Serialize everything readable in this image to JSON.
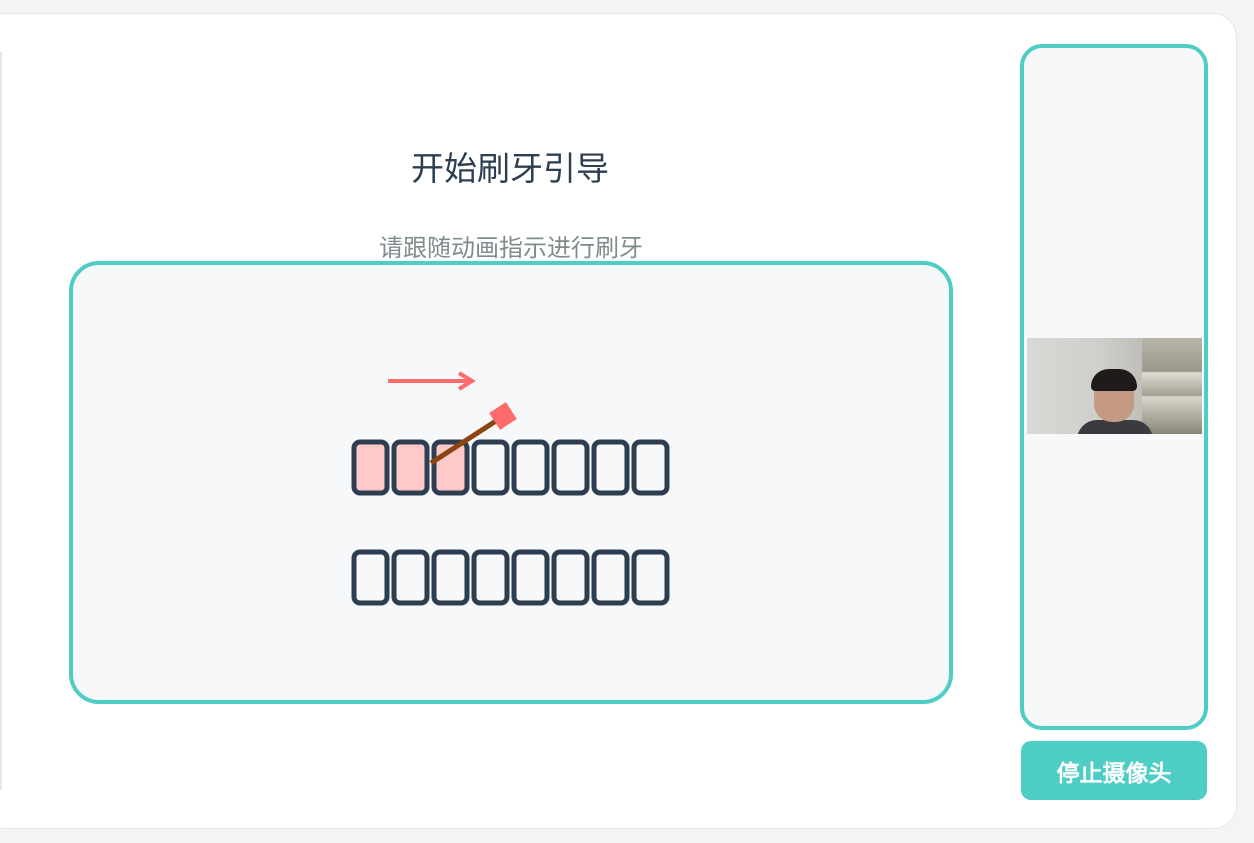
{
  "guide": {
    "title": "开始刷牙引导",
    "subtitle": "请跟随动画指示进行刷牙"
  },
  "animation": {
    "upper_teeth_count": 8,
    "lower_teeth_count": 8,
    "brushed_upper_teeth": 3,
    "direction_icon": "arrow-right-icon",
    "tool_icon": "toothbrush-icon",
    "colors": {
      "frame": "#4ecdc4",
      "tooth_outline": "#2c3e50",
      "tooth_brushed": "#ffc9c9",
      "arrow": "#ff6b6b",
      "brush_handle": "#8b4513",
      "brush_head": "#ff6b6b"
    }
  },
  "camera": {
    "stop_button_label": "停止摄像头"
  }
}
